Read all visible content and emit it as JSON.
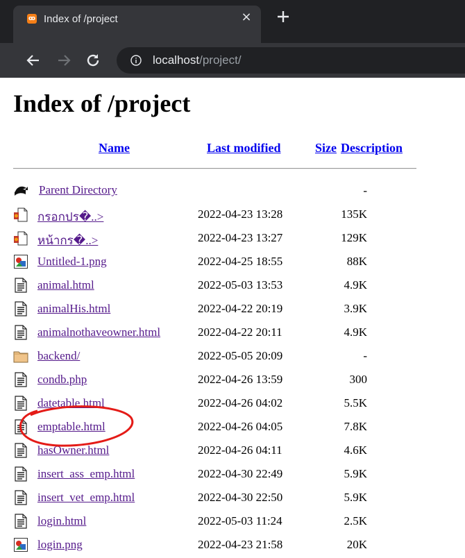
{
  "browser": {
    "tab_title": "Index of /project",
    "tab_close": "×",
    "url_host": "localhost",
    "url_path": "/project/"
  },
  "page": {
    "heading": "Index of /project",
    "columns": {
      "name": "Name",
      "last_modified": "Last modified",
      "size": "Size",
      "description": "Description"
    },
    "rows": [
      {
        "icon": "back-icon",
        "name": "Parent Directory",
        "date": "",
        "size": "-"
      },
      {
        "icon": "media-icon",
        "name": "กรอกปร�..>",
        "date": "2022-04-23 13:28",
        "size": "135K"
      },
      {
        "icon": "media-icon",
        "name": "หน้ากร�..>",
        "date": "2022-04-23 13:27",
        "size": "129K"
      },
      {
        "icon": "image-icon",
        "name": "Untitled-1.png",
        "date": "2022-04-25 18:55",
        "size": "88K"
      },
      {
        "icon": "text-file-icon",
        "name": "animal.html",
        "date": "2022-05-03 13:53",
        "size": "4.9K"
      },
      {
        "icon": "text-file-icon",
        "name": "animalHis.html",
        "date": "2022-04-22 20:19",
        "size": "3.9K"
      },
      {
        "icon": "text-file-icon",
        "name": "animalnothaveowner.html",
        "date": "2022-04-22 20:11",
        "size": "4.9K"
      },
      {
        "icon": "folder-icon",
        "name": "backend/",
        "date": "2022-05-05 20:09",
        "size": "-"
      },
      {
        "icon": "text-file-icon",
        "name": "condb.php",
        "date": "2022-04-26 13:59",
        "size": "300"
      },
      {
        "icon": "text-file-icon",
        "name": "datetable.html",
        "date": "2022-04-26 04:02",
        "size": "5.5K"
      },
      {
        "icon": "text-file-icon",
        "name": "emptable.html",
        "date": "2022-04-26 04:05",
        "size": "7.8K"
      },
      {
        "icon": "text-file-icon",
        "name": "hasOwner.html",
        "date": "2022-04-26 04:11",
        "size": "4.6K"
      },
      {
        "icon": "text-file-icon",
        "name": "insert_ass_emp.html",
        "date": "2022-04-30 22:49",
        "size": "5.9K"
      },
      {
        "icon": "text-file-icon",
        "name": "insert_vet_emp.html",
        "date": "2022-04-30 22:50",
        "size": "5.9K"
      },
      {
        "icon": "text-file-icon",
        "name": "login.html",
        "date": "2022-05-03 11:24",
        "size": "2.5K"
      },
      {
        "icon": "image-icon",
        "name": "login.png",
        "date": "2022-04-23 21:58",
        "size": "20K"
      }
    ]
  },
  "colors": {
    "link": "#0000ee",
    "visited": "#551a8b",
    "annotation": "#e41b17",
    "chrome_bg": "#202124",
    "toolbar_bg": "#35363a"
  }
}
